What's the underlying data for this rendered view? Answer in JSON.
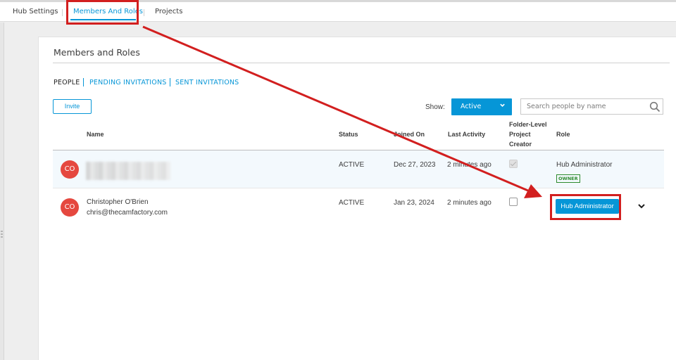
{
  "tabs": [
    {
      "label": "Hub Settings",
      "active": false
    },
    {
      "label": "Members And Roles",
      "active": true
    },
    {
      "label": "Projects",
      "active": false
    }
  ],
  "panel": {
    "title": "Members and Roles",
    "subtabs": [
      {
        "label": "PEOPLE",
        "active": true
      },
      {
        "label": "PENDING INVITATIONS",
        "active": false
      },
      {
        "label": "SENT INVITATIONS",
        "active": false
      }
    ],
    "invite_label": "Invite",
    "show_label": "Show:",
    "show_value": "Active",
    "search_placeholder": "Search people by name"
  },
  "table": {
    "headers": {
      "name": "Name",
      "status": "Status",
      "joined": "Joined On",
      "last_activity": "Last Activity",
      "folder_line1": "Folder-Level",
      "folder_line2": "Project",
      "folder_line3": "Creator",
      "role": "Role"
    },
    "rows": [
      {
        "initials": "CO",
        "name": "",
        "email": "",
        "status": "ACTIVE",
        "joined": "Dec 27, 2023",
        "last_activity": "2 minutes ago",
        "folder_creator_checked": true,
        "role": "Hub Administrator",
        "badge": "OWNER"
      },
      {
        "initials": "CO",
        "name": "Christopher O'Brien",
        "email": "chris@thecamfactory.com",
        "status": "ACTIVE",
        "joined": "Jan 23, 2024",
        "last_activity": "2 minutes ago",
        "folder_creator_checked": false,
        "role": "Hub Administrator"
      }
    ]
  },
  "colors": {
    "accent": "#0696d7",
    "avatar": "#e5483f",
    "owner_badge": "#2d8b2d",
    "annotation": "#d21f1f"
  },
  "icons": [
    "search-icon",
    "chevron-down-icon"
  ]
}
